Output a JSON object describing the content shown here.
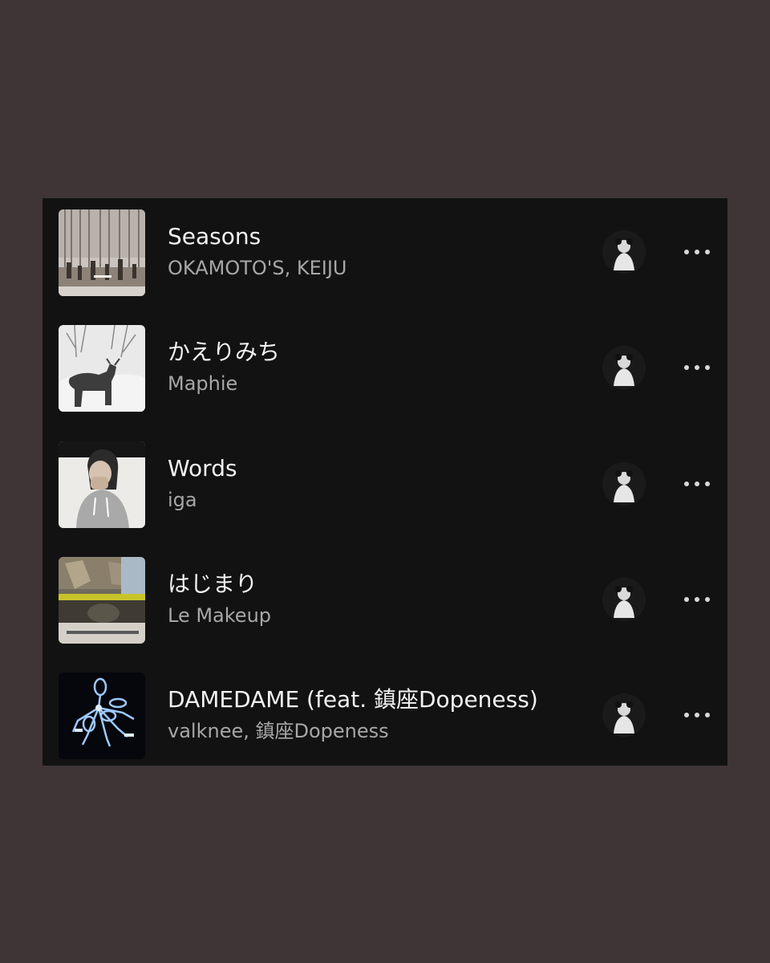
{
  "colors": {
    "background": "#3f3536",
    "panel": "#121212",
    "title_text": "#f2f2f2",
    "artist_text": "#a7a7a7"
  },
  "tracks": [
    {
      "title": "Seasons",
      "artist": "OKAMOTO'S, KEIJU",
      "art_icon": "album-art-seasons",
      "added_by_icon": "user-avatar-icon",
      "more_icon": "more-options-icon"
    },
    {
      "title": "かえりみち",
      "artist": "Maphie",
      "art_icon": "album-art-kaerimichi",
      "added_by_icon": "user-avatar-icon",
      "more_icon": "more-options-icon"
    },
    {
      "title": "Words",
      "artist": "iga",
      "art_icon": "album-art-words",
      "added_by_icon": "user-avatar-icon",
      "more_icon": "more-options-icon"
    },
    {
      "title": "はじまり",
      "artist": "Le Makeup",
      "art_icon": "album-art-hajimari",
      "added_by_icon": "user-avatar-icon",
      "more_icon": "more-options-icon"
    },
    {
      "title": "DAMEDAME (feat. 鎮座Dopeness)",
      "artist": "valknee, 鎮座Dopeness",
      "art_icon": "album-art-damedame",
      "added_by_icon": "user-avatar-icon",
      "more_icon": "more-options-icon"
    }
  ]
}
